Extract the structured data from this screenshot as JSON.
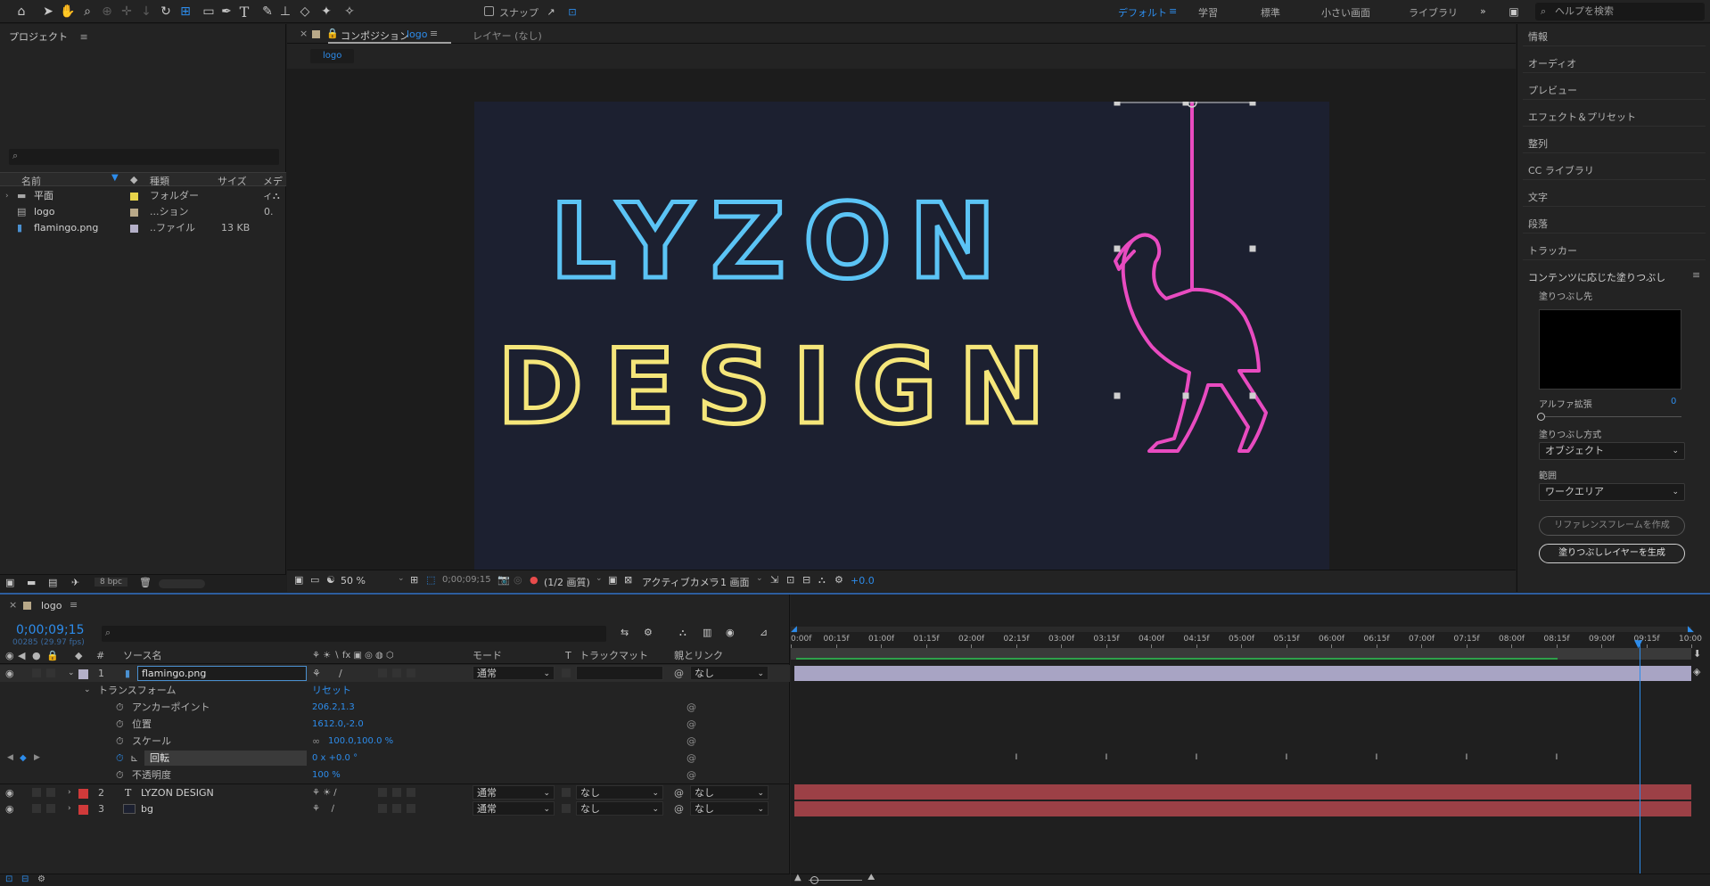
{
  "toolbar": {
    "snap_label": "スナップ",
    "workspaces": [
      {
        "label": "デフォルト",
        "active": true
      },
      {
        "label": "学習",
        "active": false
      },
      {
        "label": "標準",
        "active": false
      },
      {
        "label": "小さい画面",
        "active": false
      },
      {
        "label": "ライブラリ",
        "active": false
      }
    ],
    "more": "»",
    "menu": "≡",
    "search_placeholder": "ヘルプを検索"
  },
  "project": {
    "title": "プロジェクト",
    "columns": [
      "名前",
      "種類",
      "サイズ",
      "メディ"
    ],
    "items": [
      {
        "name": "平面",
        "type": "フォルダー",
        "size": "",
        "color": "#e8d44a"
      },
      {
        "name": "logo",
        "type": "...ション",
        "size": "0.",
        "color": "#b8a888"
      },
      {
        "name": "flamingo.png",
        "type": "..ファイル",
        "size": "13 KB",
        "color": "#b4b0c8"
      }
    ],
    "bpc": "8 bpc"
  },
  "comp": {
    "tab_prefix": "コンポジション",
    "tab_name": "logo",
    "layer_tab": "レイヤー (なし)",
    "subtab": "logo",
    "text_line1": "LYZON",
    "text_line2": "DESIGN",
    "color_line1": "#5bc4f5",
    "color_line2": "#f5e67a",
    "color_flamingo": "#e84bc0",
    "footer": {
      "zoom": "50 %",
      "timecode": "0;00;09;15",
      "resolution": "(1/2 画質)",
      "camera": "アクティブカメラ",
      "views": "1 画面",
      "exposure": "+0.0"
    }
  },
  "right_panel": {
    "items": [
      "情報",
      "オーディオ",
      "プレビュー",
      "エフェクト＆プリセット",
      "整列",
      "CC ライブラリ",
      "文字",
      "段落",
      "トラッカー"
    ],
    "cf_title": "コンテンツに応じた塗りつぶし",
    "fill_target": "塗りつぶし先",
    "alpha_label": "アルファ拡張",
    "alpha_value": "0",
    "method_label": "塗りつぶし方式",
    "method_value": "オブジェクト",
    "range_label": "範囲",
    "range_value": "ワークエリア",
    "ref_button": "リファレンスフレームを作成",
    "gen_button": "塗りつぶしレイヤーを生成"
  },
  "timeline": {
    "tab": "logo",
    "current_time": "0;00;09;15",
    "frames": "00285 (29.97 fps)",
    "col_source": "ソース名",
    "col_mode": "モード",
    "col_t": "T",
    "col_trackmatte": "トラックマット",
    "col_parent": "親とリンク",
    "transform_label": "トランスフォーム",
    "reset_label": "リセット",
    "layers": [
      {
        "num": "1",
        "name": "flamingo.png",
        "mode": "通常",
        "track": "",
        "parent": "なし",
        "color": "#b4b0c8"
      },
      {
        "num": "2",
        "name": "LYZON DESIGN",
        "mode": "通常",
        "track": "なし",
        "parent": "なし",
        "color": "#d03a3a"
      },
      {
        "num": "3",
        "name": "bg",
        "mode": "通常",
        "track": "なし",
        "parent": "なし",
        "color": "#d03a3a"
      }
    ],
    "props": [
      {
        "name": "アンカーポイント",
        "value": "206.2,1.3"
      },
      {
        "name": "位置",
        "value": "1612.0,-2.0"
      },
      {
        "name": "スケール",
        "value": "100.0,100.0 %"
      },
      {
        "name": "回転",
        "value": "0 x +0.0 °"
      },
      {
        "name": "不透明度",
        "value": "100 %"
      }
    ],
    "ruler": [
      "0:00f",
      "00:15f",
      "01:00f",
      "01:15f",
      "02:00f",
      "02:15f",
      "03:00f",
      "03:15f",
      "04:00f",
      "04:15f",
      "05:00f",
      "05:15f",
      "06:00f",
      "06:15f",
      "07:00f",
      "07:15f",
      "08:00f",
      "08:15f",
      "09:00f",
      "09:15f",
      "10:00"
    ]
  }
}
